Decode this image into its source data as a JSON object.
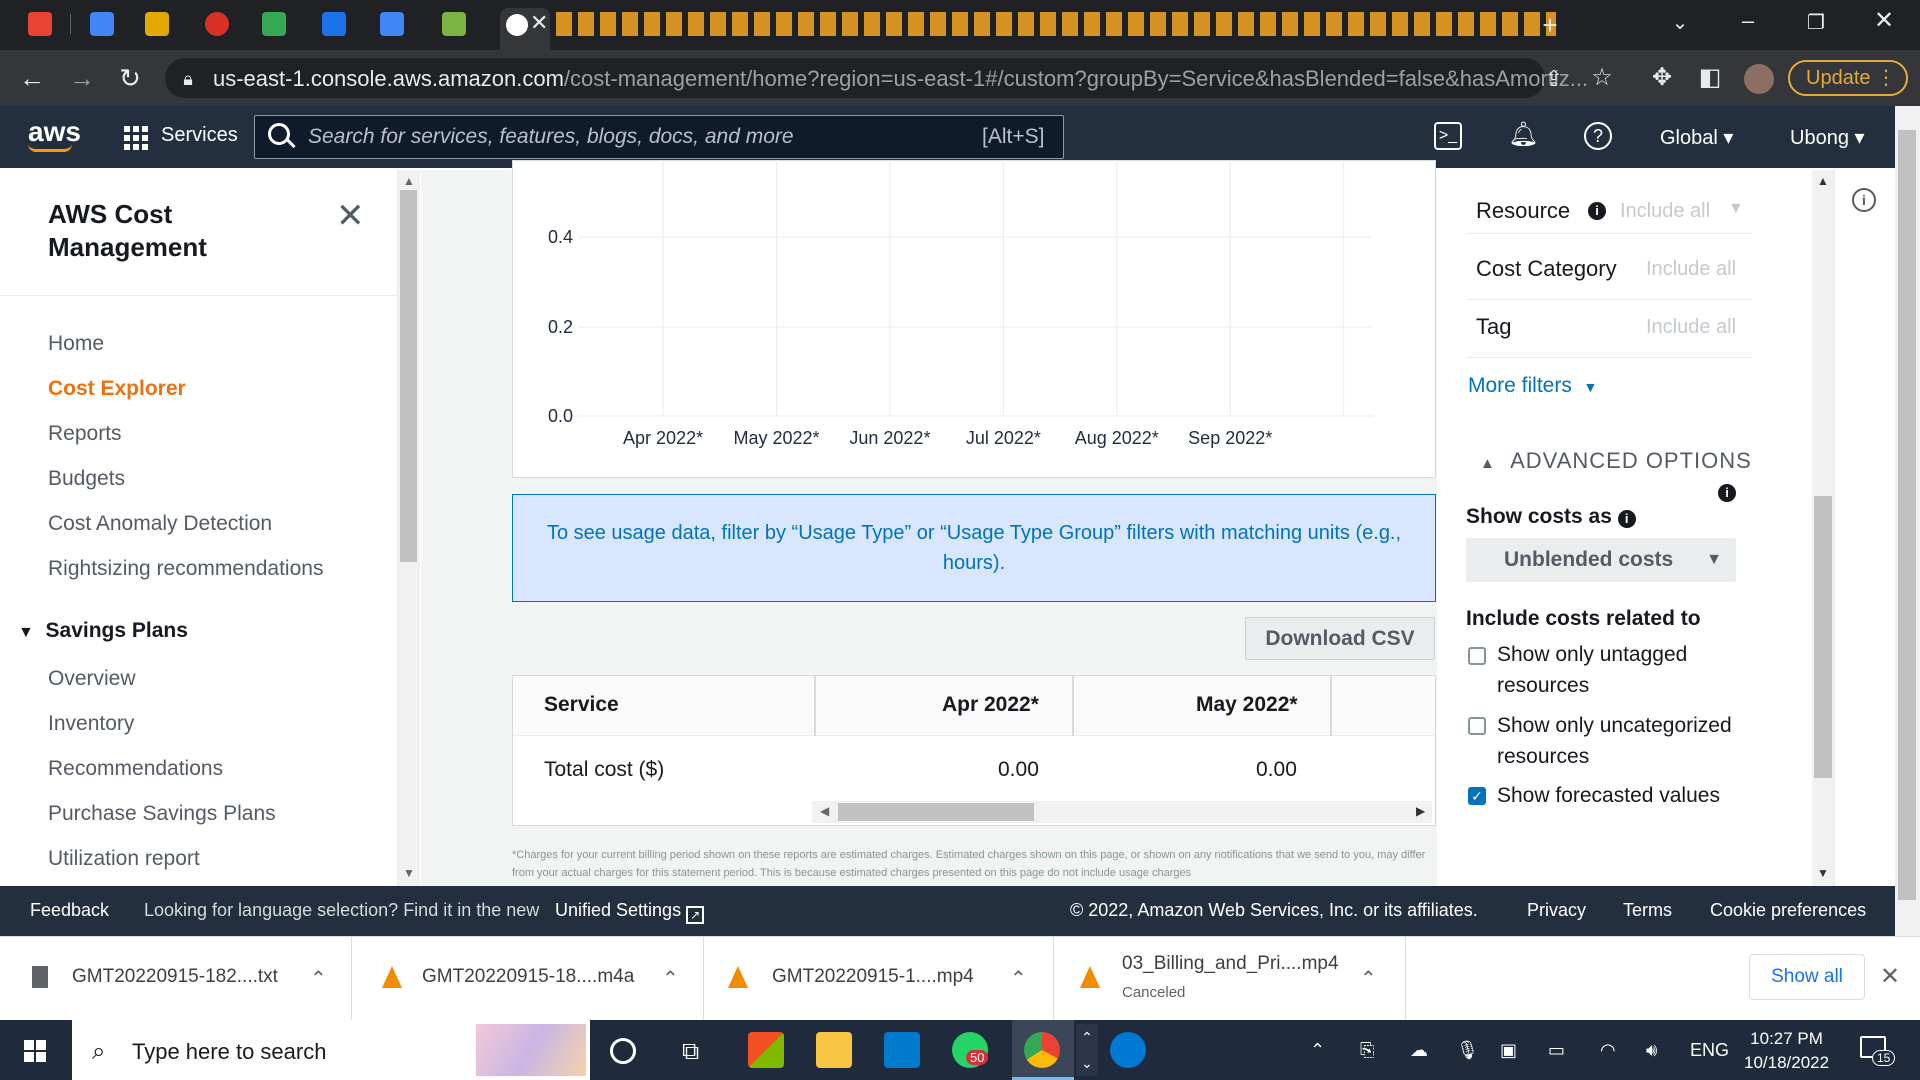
{
  "browser": {
    "url_host": "us-east-1.console.aws.amazon.com",
    "url_path": "/cost-management/home?region=us-east-1#/custom?groupBy=Service&hasBlended=false&hasAmortiz...",
    "update_label": "Update"
  },
  "aws_nav": {
    "logo": "aws",
    "services_label": "Services",
    "search_placeholder": "Search for services, features, blogs, docs, and more",
    "search_shortcut": "[Alt+S]",
    "region": "Global ▾",
    "user": "Ubong ▾"
  },
  "sidebar": {
    "title": "AWS Cost Management",
    "items": [
      {
        "label": "Home"
      },
      {
        "label": "Cost Explorer"
      },
      {
        "label": "Reports"
      },
      {
        "label": "Budgets"
      },
      {
        "label": "Cost Anomaly Detection"
      },
      {
        "label": "Rightsizing recommendations"
      }
    ],
    "section": "Savings Plans",
    "section_items": [
      {
        "label": "Overview"
      },
      {
        "label": "Inventory"
      },
      {
        "label": "Recommendations"
      },
      {
        "label": "Purchase Savings Plans"
      },
      {
        "label": "Utilization report"
      }
    ]
  },
  "chart_data": {
    "type": "bar",
    "categories": [
      "Apr 2022*",
      "May 2022*",
      "Jun 2022*",
      "Jul 2022*",
      "Aug 2022*",
      "Sep 2022*"
    ],
    "values": [
      0,
      0,
      0,
      0,
      0,
      0
    ],
    "yticks": [
      "0.4",
      "0.2",
      "0.0"
    ],
    "grid": true
  },
  "info_banner": "To see usage data, filter by “Usage Type” or “Usage Type Group” filters with matching units (e.g., hours).",
  "download_csv": "Download CSV",
  "table": {
    "headers": [
      "Service",
      "Apr 2022*",
      "May 2022*"
    ],
    "rows": [
      {
        "label": "Total cost ($)",
        "values": [
          "0.00",
          "0.00"
        ]
      }
    ]
  },
  "disclaimer": "*Charges for your current billing period shown on these reports are estimated charges. Estimated charges shown on this page, or shown on any notifications that we send to you, may differ from your actual charges for this statement period. This is because estimated charges presented on this page do not include usage charges",
  "filters": {
    "resource": {
      "label": "Resource",
      "value": "Include all"
    },
    "cost_category": {
      "label": "Cost Category",
      "value": "Include all"
    },
    "tag": {
      "label": "Tag",
      "value": "Include all"
    },
    "more_filters": "More filters"
  },
  "advanced": {
    "title": "ADVANCED OPTIONS",
    "show_costs_as": "Show costs as",
    "show_costs_value": "Unblended costs",
    "include_title": "Include costs related to",
    "options": [
      {
        "label": "Show only untagged resources",
        "checked": false
      },
      {
        "label": "Show only uncategorized resources",
        "checked": false
      },
      {
        "label": "Show forecasted values",
        "checked": true
      }
    ]
  },
  "footer": {
    "feedback": "Feedback",
    "language_prompt": "Looking for language selection? Find it in the new",
    "unified_settings": "Unified Settings",
    "copyright": "© 2022, Amazon Web Services, Inc. or its affiliates.",
    "privacy": "Privacy",
    "terms": "Terms",
    "cookies": "Cookie preferences"
  },
  "downloads": {
    "items": [
      {
        "name": "GMT20220915-182....txt",
        "sub": ""
      },
      {
        "name": "GMT20220915-18....m4a",
        "sub": ""
      },
      {
        "name": "GMT20220915-1....mp4",
        "sub": ""
      },
      {
        "name": "03_Billing_and_Pri....mp4",
        "sub": "Canceled"
      }
    ],
    "show_all": "Show all"
  },
  "taskbar": {
    "search_placeholder": "Type here to search",
    "lang": "ENG",
    "time": "10:27 PM",
    "date": "10/18/2022",
    "whatsapp_badge": "50",
    "notif_badge": "15"
  }
}
